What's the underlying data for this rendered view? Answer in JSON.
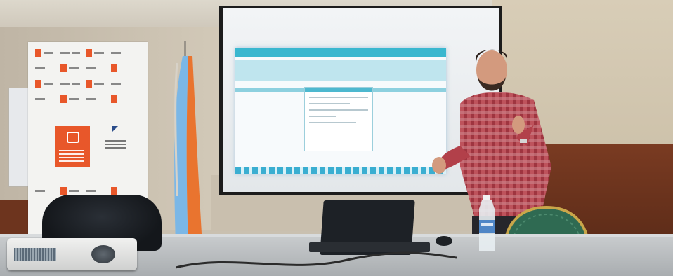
{
  "scene": {
    "description_items": [
      "banner",
      "flag",
      "projector-screen",
      "presenter",
      "laptop",
      "projector",
      "water-bottle",
      "chair"
    ]
  },
  "colors": {
    "banner_orange": "#e8572a",
    "screen_accent": "#3ab7cf",
    "flag_blue": "#7bb7e6",
    "flag_orange": "#e9742f",
    "shirt_red": "#b2404a",
    "chair_green": "#2f6a52"
  },
  "icons": {
    "banner_logo": "logo-icon"
  }
}
